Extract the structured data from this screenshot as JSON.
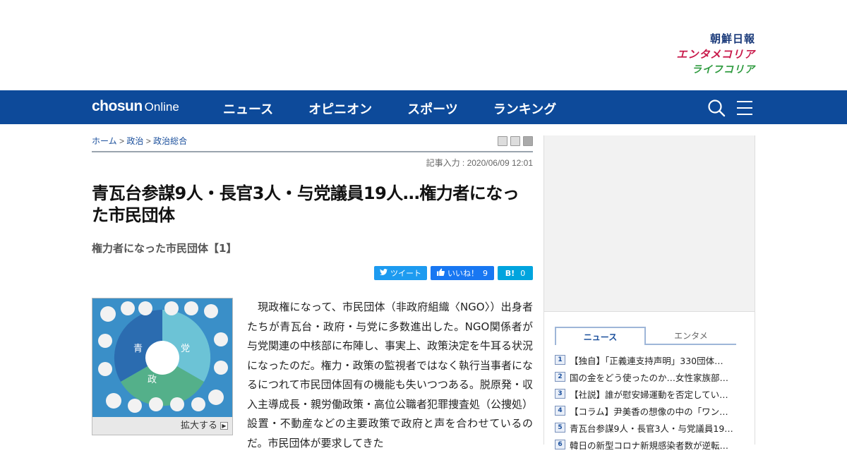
{
  "brands": {
    "chosun_ilbo": "朝鮮日報",
    "entame_korea": "エンタメコリア",
    "life_korea": "ライフコリア"
  },
  "nav": {
    "logo_bold": "chosun",
    "logo_light": "Online",
    "items": [
      "ニュース",
      "オピニオン",
      "スポーツ",
      "ランキング"
    ],
    "icons": [
      "search-icon",
      "hamburger-menu-icon"
    ]
  },
  "article": {
    "breadcrumb": [
      "ホーム",
      "政治",
      "政治総合"
    ],
    "breadcrumb_sep": ">",
    "dateline": "記事入力 : 2020/06/09 12:01",
    "headline": "青瓦台参謀9人・長官3人・与党議員19人…権力者になった市民団体",
    "subhead": "権力者になった市民団体【1】",
    "share": {
      "tweet": "ツイート",
      "like": "いいね！",
      "like_count": "9",
      "hatena": "B!",
      "hatena_count": "0"
    },
    "figure_caption": "拡大する",
    "figure_labels": {
      "blue": "青",
      "government": "政",
      "party": "党"
    },
    "body": "現政権になって、市民団体（非政府組織〈NGO〉）出身者たちが青瓦台・政府・与党に多数進出した。NGO関係者が与党関連の中核部に布陣し、事実上、政策決定を牛耳る状況になったのだ。権力・政策の監視者ではなく執行当事者になるにつれて市民団体固有の機能も失いつつある。脱原発・収入主導成長・親労働政策・高位公職者犯罪捜査処（公捜処）設置・不動産などの主要政策で政府と声を合わせているのだ。市民団体が要求してきた"
  },
  "sidebar": {
    "tabs": [
      "ニュース",
      "エンタメ"
    ],
    "ranking": [
      {
        "rank": "1",
        "title": "【独自】「正義連支持声明」330団体…"
      },
      {
        "rank": "2",
        "title": "国の金をどう使ったのか…女性家族部…"
      },
      {
        "rank": "3",
        "title": "【社説】誰が慰安婦運動を否定してい…"
      },
      {
        "rank": "4",
        "title": "【コラム】尹美香の想像の中の「ワン…"
      },
      {
        "rank": "5",
        "title": "青瓦台参謀9人・長官3人・与党議員19…"
      },
      {
        "rank": "6",
        "title": "韓日の新型コロナ新規感染者数が逆転…"
      }
    ]
  },
  "colors": {
    "nav_bg": "#0d4a9a",
    "brand_red": "#c8194a",
    "brand_green": "#2d9a3e",
    "twitter": "#1d9bf0",
    "facebook": "#1877f2",
    "hatena": "#00a4de"
  }
}
